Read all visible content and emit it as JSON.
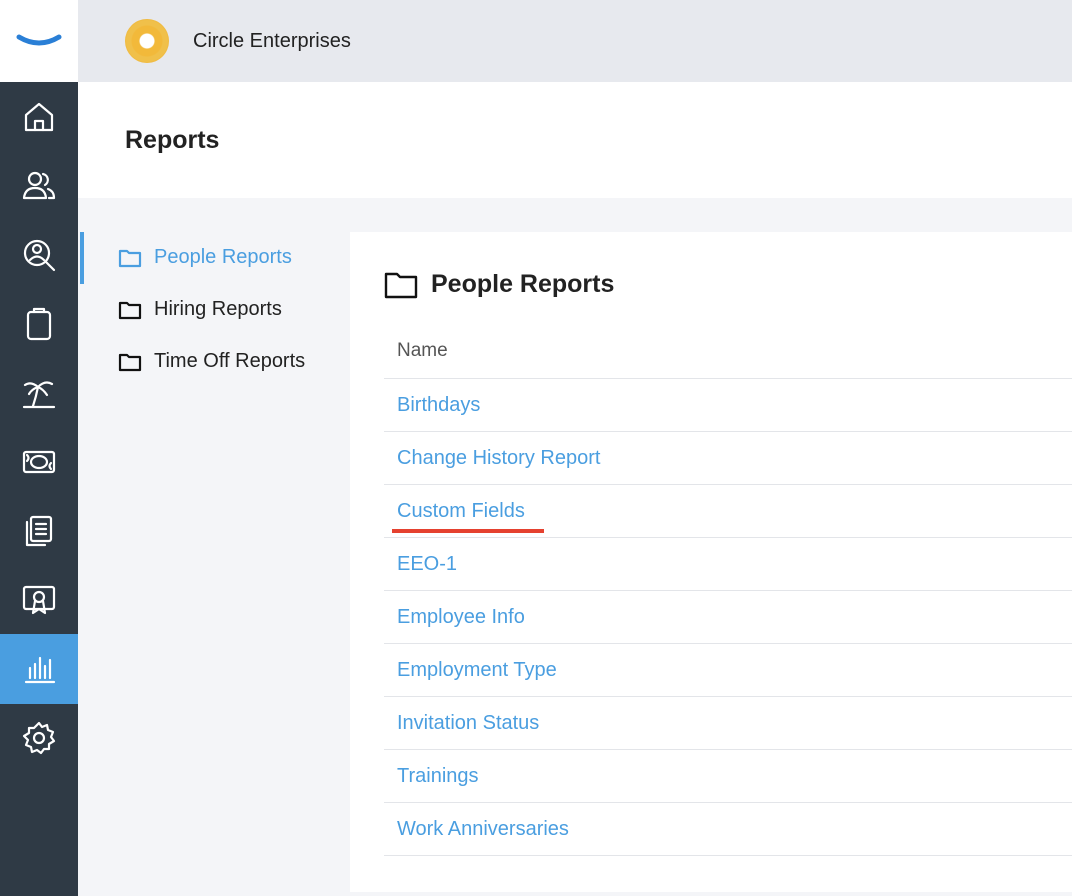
{
  "company": {
    "name": "Circle Enterprises"
  },
  "page": {
    "title": "Reports"
  },
  "rail": {
    "items": [
      {
        "icon": "home-icon"
      },
      {
        "icon": "people-icon"
      },
      {
        "icon": "search-person-icon"
      },
      {
        "icon": "clipboard-icon"
      },
      {
        "icon": "palm-tree-icon"
      },
      {
        "icon": "money-icon"
      },
      {
        "icon": "documents-icon"
      },
      {
        "icon": "certificate-icon"
      },
      {
        "icon": "reports-chart-icon",
        "active": true
      },
      {
        "icon": "gear-icon"
      }
    ]
  },
  "subnav": {
    "items": [
      {
        "label": "People Reports",
        "active": true
      },
      {
        "label": "Hiring Reports"
      },
      {
        "label": "Time Off Reports"
      }
    ]
  },
  "panel": {
    "title": "People Reports",
    "column_header": "Name",
    "rows": [
      "Birthdays",
      "Change History Report",
      "Custom Fields",
      "EEO-1",
      "Employee Info",
      "Employment Type",
      "Invitation Status",
      "Trainings",
      "Work Anniversaries"
    ]
  },
  "colors": {
    "accent": "#4a9ee0",
    "rail_bg": "#2f3a45",
    "highlight_underline": "#e5412f"
  }
}
